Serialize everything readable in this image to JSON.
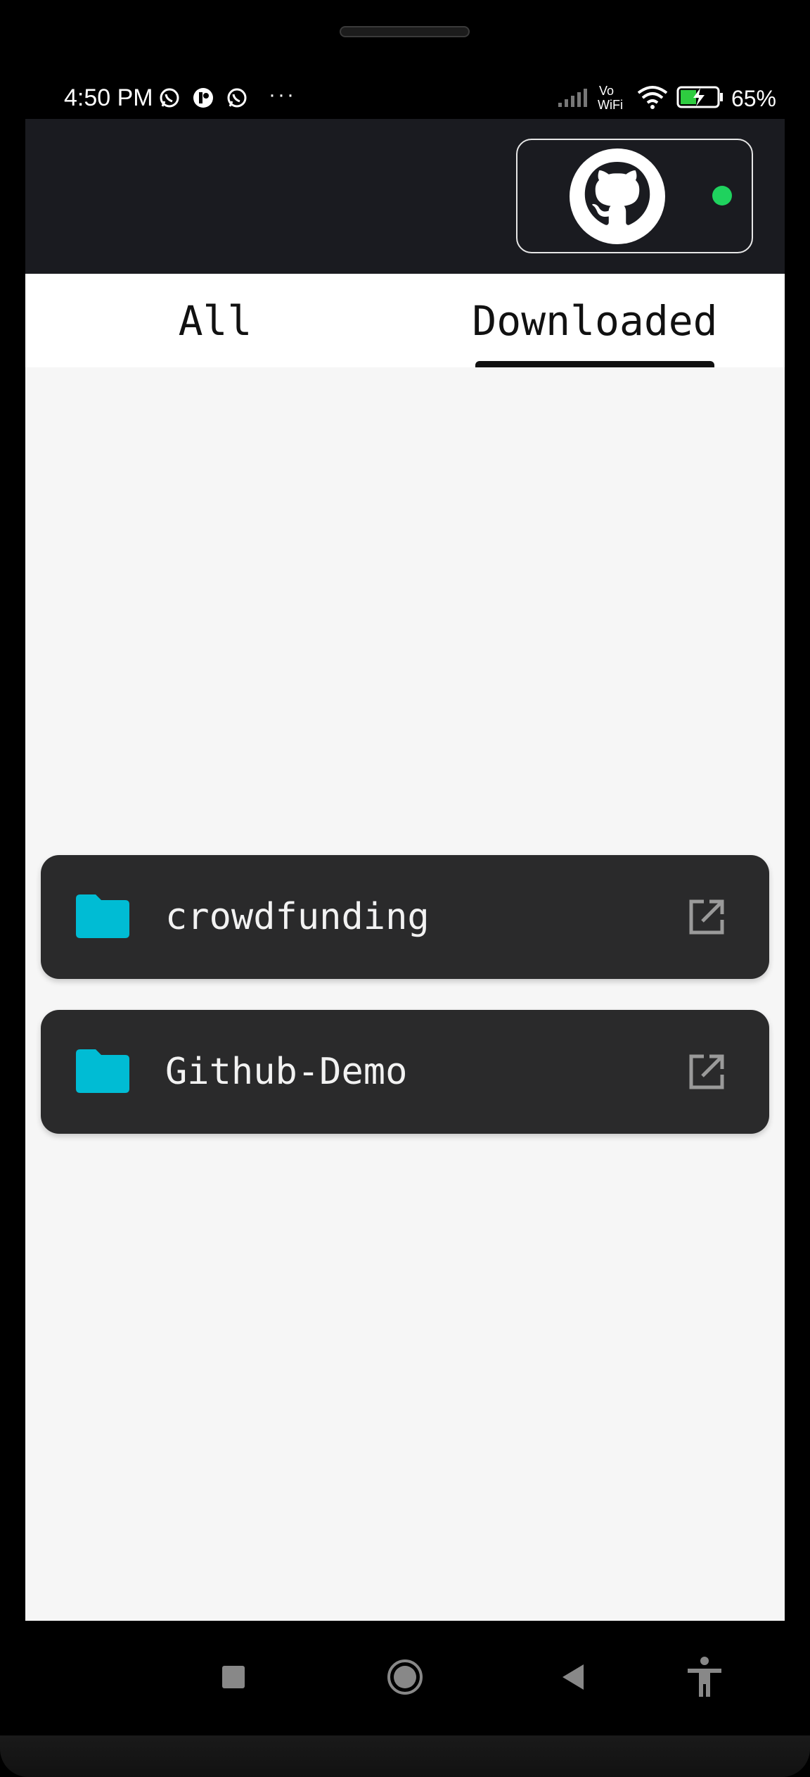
{
  "status_bar": {
    "time": "4:50 PM",
    "battery_percent": "65%",
    "icons_left": [
      "whatsapp-icon",
      "app-icon",
      "whatsapp-icon",
      "more-dots-icon"
    ],
    "icons_right": [
      "signal-icon",
      "vowifi-icon",
      "wifi-icon",
      "battery-charging-icon"
    ],
    "vowifi_text": "Vo WiFi",
    "overflow_text": "···"
  },
  "header": {
    "account_icon": "github-icon",
    "online_status_color": "#1fd25e"
  },
  "tabs": [
    {
      "label": "All",
      "selected": false
    },
    {
      "label": "Downloaded",
      "selected": true
    }
  ],
  "repositories": [
    {
      "name": "crowdfunding",
      "icon": "folder-icon",
      "action_icon": "open-external-icon"
    },
    {
      "name": "Github-Demo",
      "icon": "folder-icon",
      "action_icon": "open-external-icon"
    }
  ],
  "nav_bar": {
    "buttons": [
      "recents-button",
      "home-button",
      "back-button",
      "accessibility-button"
    ]
  },
  "colors": {
    "appbar_bg": "#1a1b20",
    "card_bg": "#2a2a2b",
    "folder_accent": "#00bcd4",
    "content_bg": "#f6f6f6"
  }
}
